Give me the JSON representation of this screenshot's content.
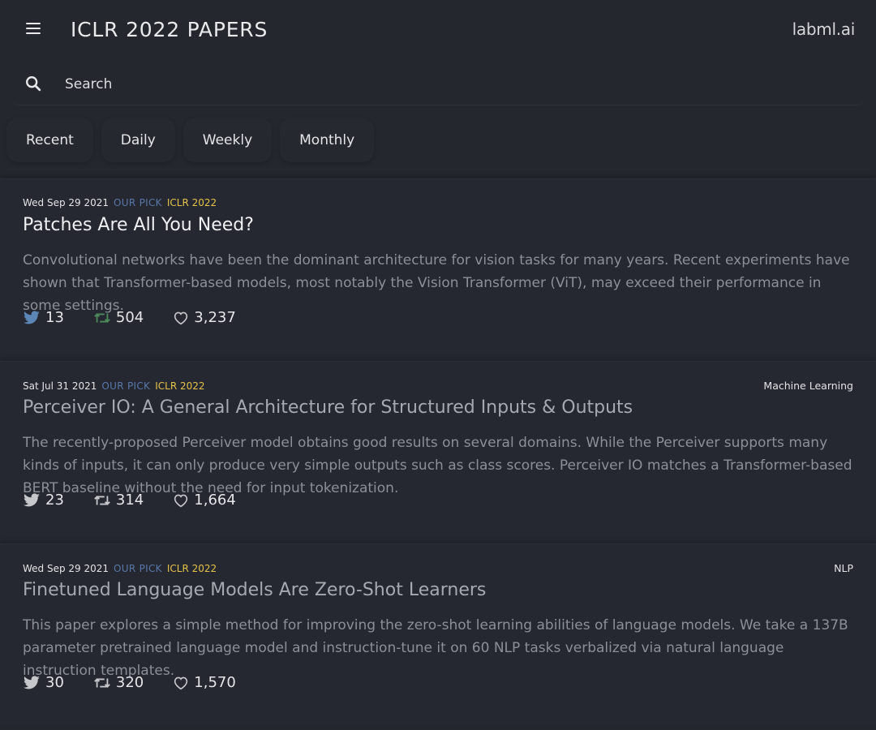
{
  "header": {
    "title": "ICLR 2022 PAPERS",
    "brand": "labml.ai"
  },
  "search": {
    "placeholder": "Search",
    "value": ""
  },
  "tabs": [
    {
      "label": "Recent"
    },
    {
      "label": "Daily"
    },
    {
      "label": "Weekly"
    },
    {
      "label": "Monthly"
    }
  ],
  "colors": {
    "background": "#24272e",
    "our_pick": "#5877a8",
    "conference": "#e4c24a",
    "retweet_green": "#4c8a5c",
    "twitter_blue": "#5b86b5"
  },
  "papers": [
    {
      "date": "Wed Sep 29 2021",
      "pick": "OUR PICK",
      "conference": "ICLR 2022",
      "topic": "",
      "title": "Patches Are All You Need?",
      "abstract": "Convolutional networks have been the dominant architecture for vision tasks for many years. Recent experiments have shown that Transformer-based models, most notably the Vision Transformer (ViT), may exceed their performance in some settings.",
      "tweets": "13",
      "retweets": "504",
      "likes": "3,237"
    },
    {
      "date": "Sat Jul 31 2021",
      "pick": "OUR PICK",
      "conference": "ICLR 2022",
      "topic": "Machine Learning",
      "title": "Perceiver IO: A General Architecture for Structured Inputs & Outputs",
      "abstract": "The recently-proposed Perceiver model obtains good results on several domains. While the Perceiver supports many kinds of inputs, it can only produce very simple outputs such as class scores. Perceiver IO matches a Transformer-based BERT baseline without the need for input tokenization.",
      "tweets": "23",
      "retweets": "314",
      "likes": "1,664"
    },
    {
      "date": "Wed Sep 29 2021",
      "pick": "OUR PICK",
      "conference": "ICLR 2022",
      "topic": "NLP",
      "title": "Finetuned Language Models Are Zero-Shot Learners",
      "abstract": "This paper explores a simple method for improving the zero-shot learning abilities of language models. We take a 137B parameter pretrained language model and instruction-tune it on 60 NLP tasks verbalized via natural language instruction templates.",
      "tweets": "30",
      "retweets": "320",
      "likes": "1,570"
    }
  ]
}
